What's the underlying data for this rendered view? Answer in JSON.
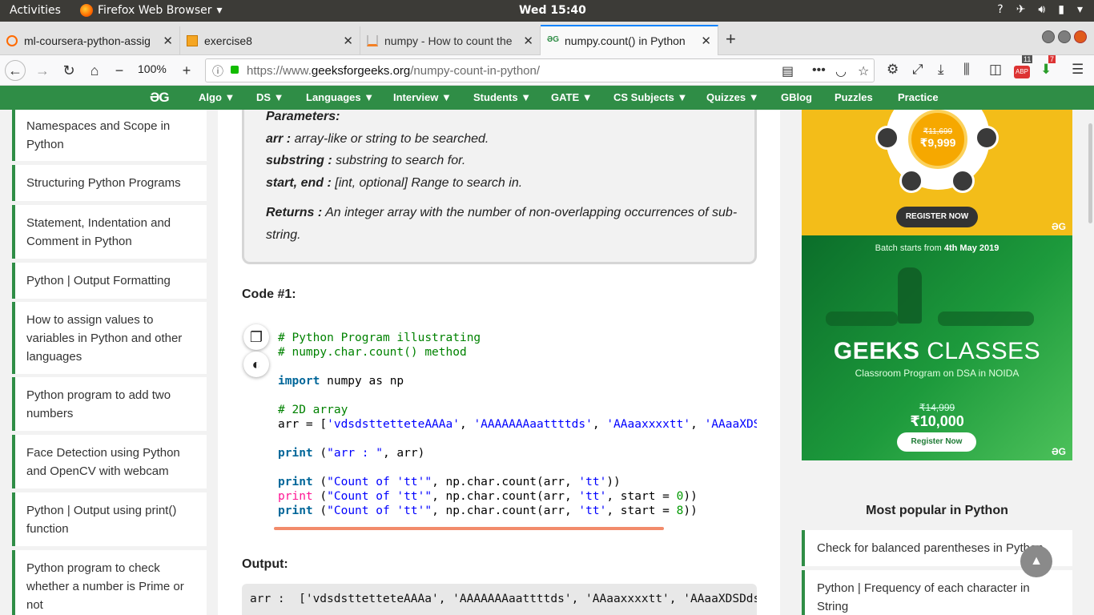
{
  "system": {
    "activities": "Activities",
    "app": "Firefox Web Browser",
    "clock": "Wed 15:40"
  },
  "tabs": [
    {
      "title": "ml-coursera-python-assig",
      "favicon": "coursera-icon"
    },
    {
      "title": "exercise8",
      "favicon": "document-icon"
    },
    {
      "title": "numpy - How to count the",
      "favicon": "stackoverflow-icon"
    },
    {
      "title": "numpy.count() in Python",
      "favicon": "gfg-icon"
    }
  ],
  "nav": {
    "zoom": "100%",
    "url_prefix": "https://www.",
    "url_domain": "geeksforgeeks.org",
    "url_path": "/numpy-count-in-python/",
    "library_badge": "11",
    "addon_badge": "7"
  },
  "gfg_nav": {
    "logo": "ƏG",
    "items": [
      "Algo ▼",
      "DS ▼",
      "Languages ▼",
      "Interview ▼",
      "Students ▼",
      "GATE ▼",
      "CS Subjects ▼",
      "Quizzes ▼",
      "GBlog",
      "Puzzles",
      "Practice"
    ]
  },
  "left_links": [
    "Namespaces and Scope in Python",
    "Structuring Python Programs",
    "Statement, Indentation and Comment in Python",
    "Python | Output Formatting",
    "How to assign values to variables in Python and other languages",
    "Python program to add two numbers",
    "Face Detection using Python and OpenCV with webcam",
    "Python | Output using print() function",
    "Python program to check whether a number is Prime or not"
  ],
  "params": {
    "heading": "Parameters:",
    "arr_key": "arr :",
    "arr_desc": " array-like or string to be searched.",
    "sub_key": "substring :",
    "sub_desc": " substring to search for.",
    "se_key": "start, end :",
    "se_desc": " [int, optional] Range to search in.",
    "ret_key": "Returns :",
    "ret_desc1": " An integer array with the number of non-overlapping occurrences of sub-",
    "ret_desc2": "string."
  },
  "code_label": "Code #1:",
  "code": {
    "l1": "# Python Program illustrating",
    "l2": "# numpy.char.count() method",
    "kw_import": "import",
    "l3_rest": " numpy as np",
    "l4": "# 2D array",
    "l5_a": "arr = [",
    "l5_s1": "'vdsdsttetteteAAAa'",
    "l5_c1": ", ",
    "l5_s2": "'AAAAAAAaattttds'",
    "l5_c2": ", ",
    "l5_s3": "'AAaaxxxxtt'",
    "l5_c3": ", ",
    "l5_s4": "'AAaaXDSDdscz'",
    "l5_e": "]",
    "kw_print": "print",
    "l6_a": " (",
    "l6_s": "\"arr : \"",
    "l6_b": ", arr)",
    "p_open": " (",
    "s_count": "\"Count of 'tt'\"",
    "c_mid": ", np.char.count(arr, ",
    "s_tt": "'tt'",
    "l7_end": "))",
    "l8_mid": ", start = ",
    "n0": "0",
    "n8": "8",
    "l8_end": "))"
  },
  "output_label": "Output:",
  "output": {
    "line1": "arr :  ['vdsdsttetteteAAAa', 'AAAAAAAaattttds', 'AAaaxxxxtt', 'AAaaXDSDdscz']"
  },
  "ad1": {
    "old_price": "₹11,699",
    "new_price": "₹9,999",
    "button": "REGISTER NOW",
    "mark": "ƏG"
  },
  "ad2": {
    "batch_pre": "Batch starts from ",
    "batch_date": "4th May 2019",
    "title_bold": "GEEKS",
    "title_rest": " CLASSES",
    "subtitle": "Classroom Program on DSA in NOIDA",
    "old_price": "₹14,999",
    "new_price": "₹10,000",
    "button": "Register Now",
    "mark": "ƏG"
  },
  "popular": {
    "heading": "Most popular in Python",
    "items": [
      "Check for balanced parentheses in Python",
      "Python | Frequency of each character in String"
    ]
  },
  "colors": {
    "gfg_green": "#2f8d46",
    "accent_blue": "#0a84ff"
  }
}
